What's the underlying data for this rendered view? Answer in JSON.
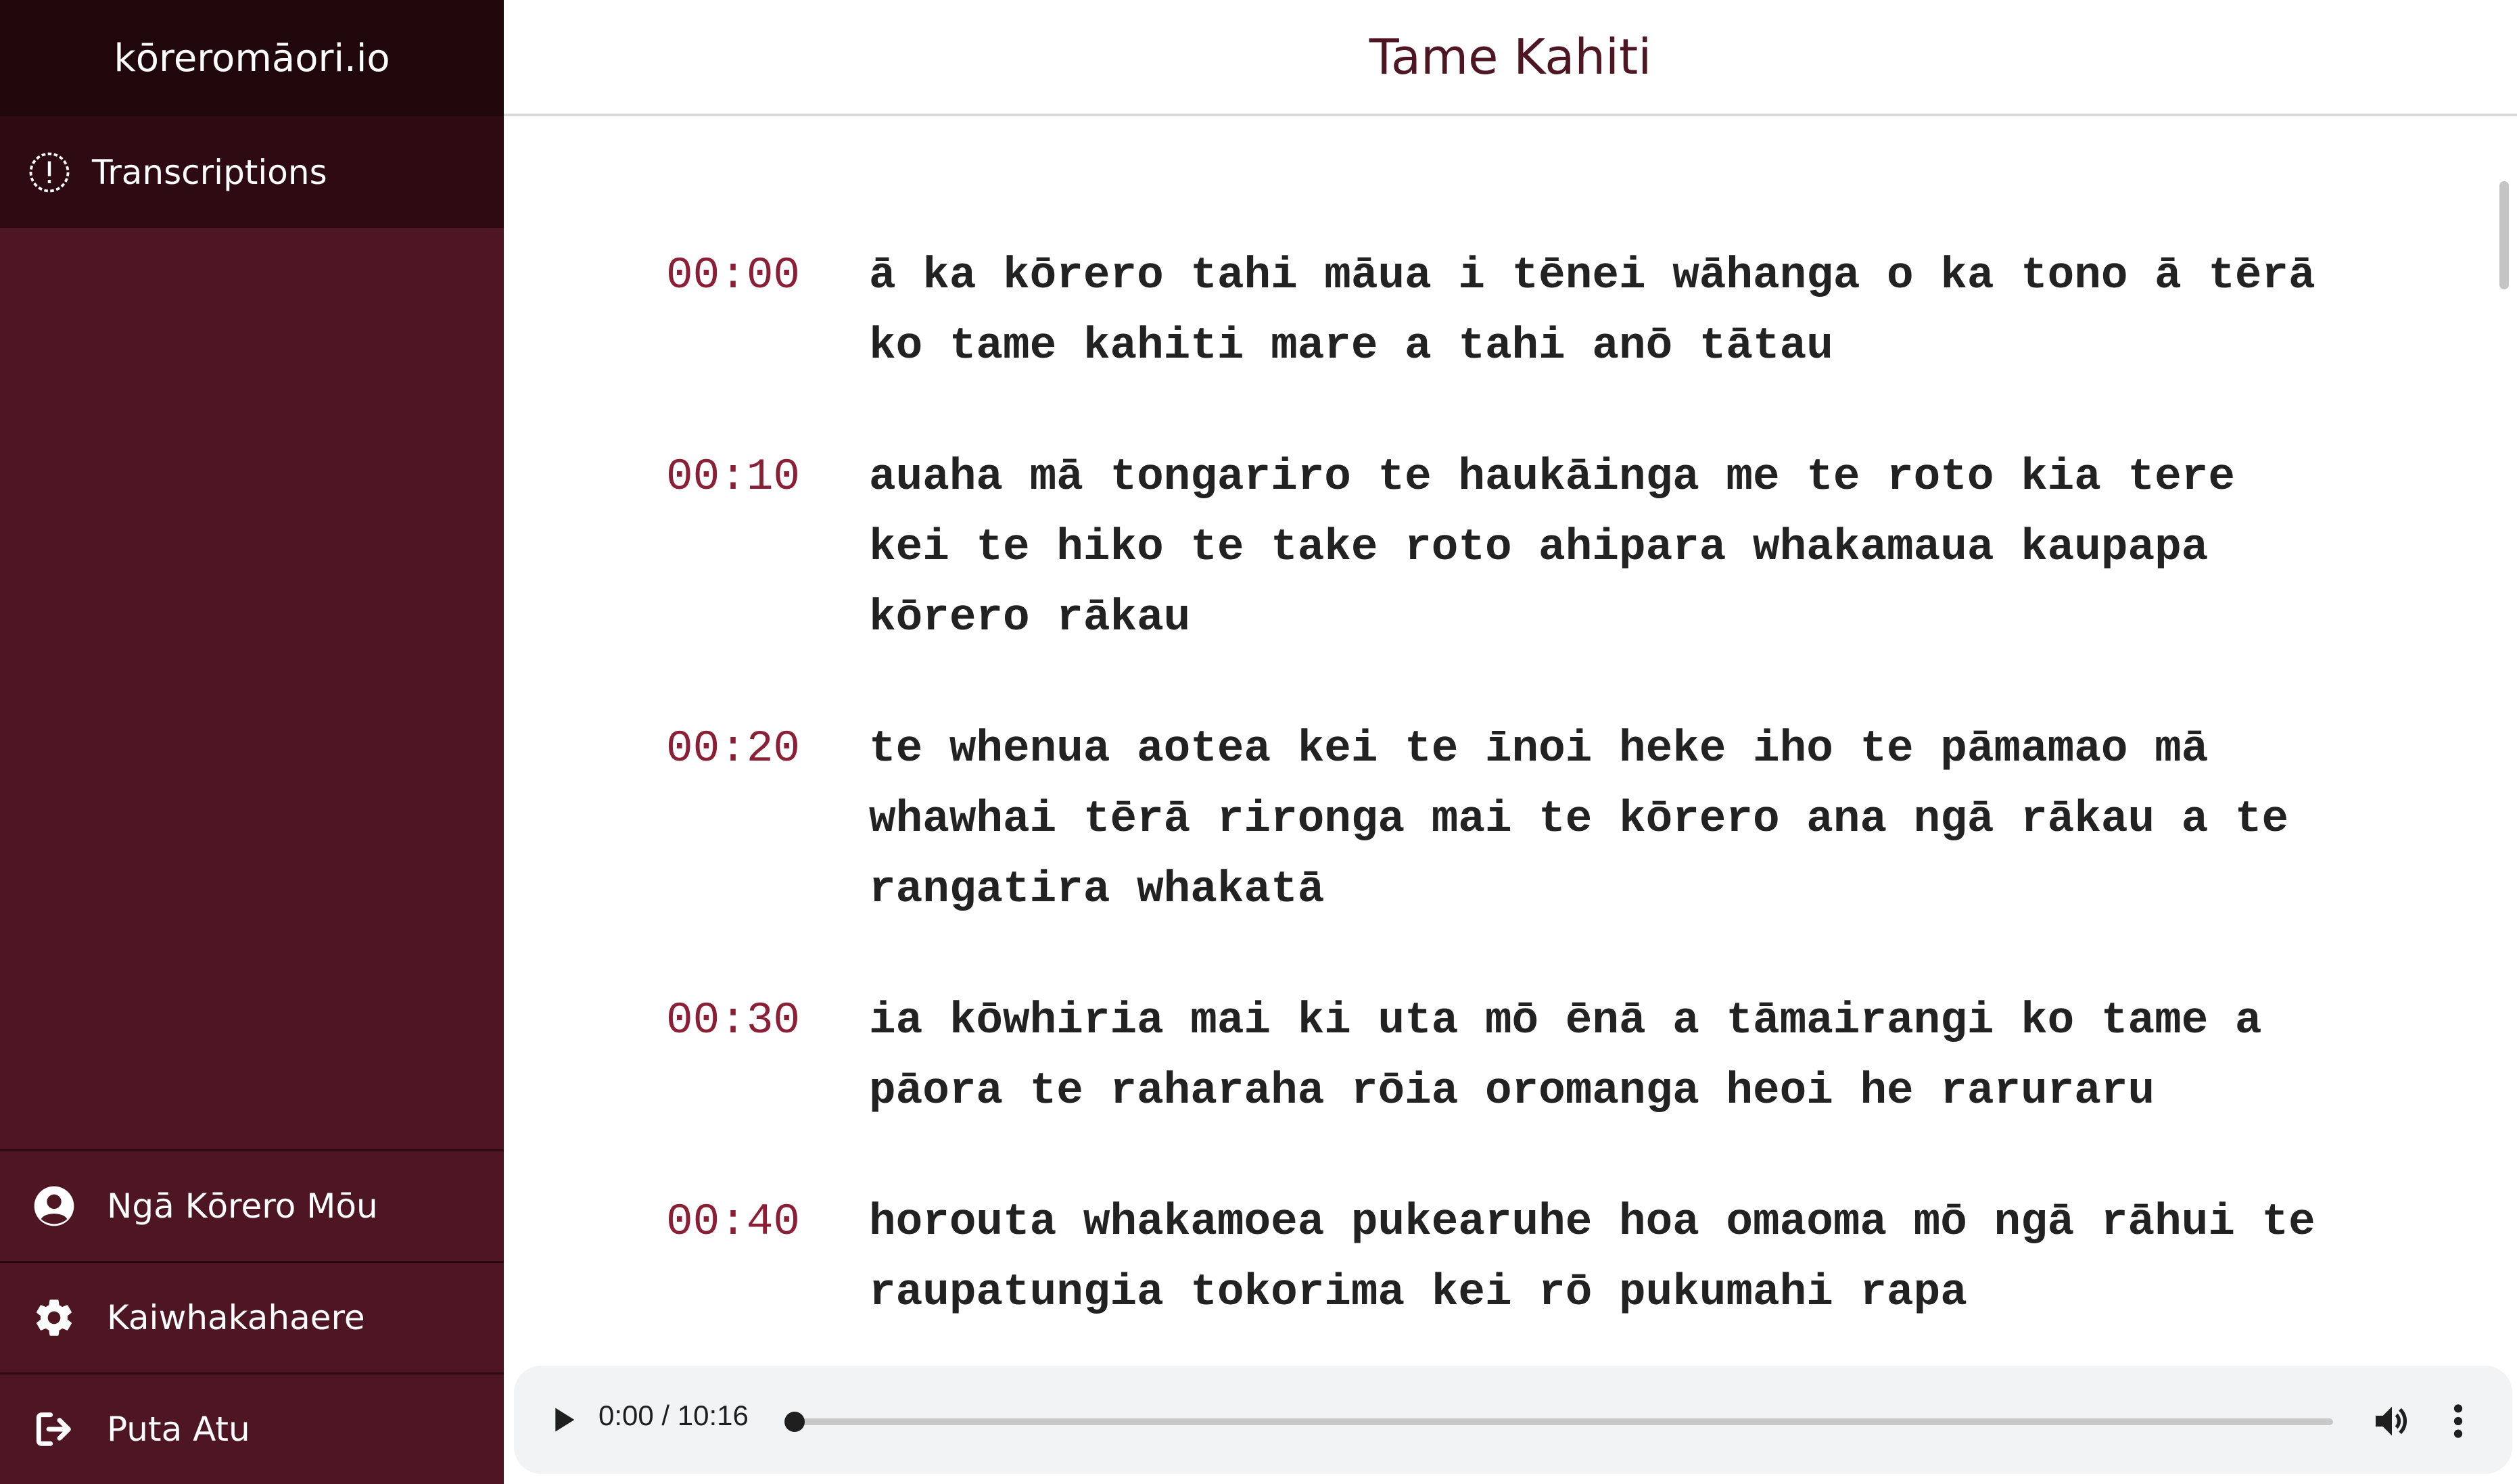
{
  "app": {
    "brand": "kōreromāori.io"
  },
  "sidebar": {
    "active_item": {
      "label": "Transcriptions",
      "icon": "alert-circle-icon"
    },
    "bottom_items": [
      {
        "label": "Ngā Kōrero Mōu",
        "icon": "user-circle-icon"
      },
      {
        "label": "Kaiwhakahaere",
        "icon": "gear-icon"
      },
      {
        "label": "Puta Atu",
        "icon": "sign-out-icon"
      }
    ]
  },
  "header": {
    "title": "Tame Kahiti"
  },
  "transcript": {
    "segments": [
      {
        "time": "00:00",
        "text": "ā ka kōrero tahi māua i tēnei wāhanga o ka tono ā tērā ko tame kahiti mare a tahi anō tātau"
      },
      {
        "time": "00:10",
        "text": "auaha mā tongariro te haukāinga me te roto kia tere kei te hiko te take roto ahipara whakamaua kaupapa kōrero rākau"
      },
      {
        "time": "00:20",
        "text": "te whenua aotea kei te īnoi heke iho te pāmamao mā whawhai tērā rironga mai te kōrero ana ngā rākau a te rangatira whakatā"
      },
      {
        "time": "00:30",
        "text": "ia kōwhiria mai ki uta mō ēnā a tāmairangi ko tame a pāora te raharaha rōia oromanga heoi he raruraru"
      },
      {
        "time": "00:40",
        "text": "horouta whakamoea pukearuhe hoa omaoma mō ngā rāhui te raupatungia tokorima kei rō pukumahi rapa"
      }
    ]
  },
  "player": {
    "time_display": "0:00 / 10:16",
    "progress": 0
  },
  "colors": {
    "sidebar": "#4e1522",
    "brand_bar": "#1f070b",
    "active_item": "#2e0a12",
    "accent": "#8a1f36"
  }
}
